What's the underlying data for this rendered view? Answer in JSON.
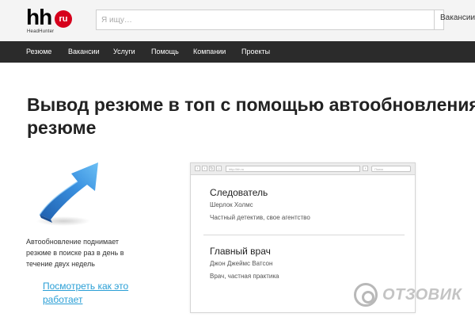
{
  "header": {
    "logo_text": "hh",
    "logo_badge": "ru",
    "logo_subtitle": "HeadHunter",
    "search_placeholder": "Я ищу…",
    "search_scope": "Вакансии"
  },
  "nav": {
    "items": [
      "Резюме",
      "Вакансии",
      "Услуги",
      "Помощь",
      "Компании",
      "Проекты"
    ]
  },
  "page": {
    "title_line1": "Вывод резюме в топ с помощью автообновления",
    "title_line2": "резюме",
    "description": "Автообновление поднимает резюме в поиске раз в день в течение двух недель",
    "link": "Посмотреть как это работает"
  },
  "mock_browser": {
    "url": "http://hh.ru",
    "search": "Поиск",
    "results": [
      {
        "title": "Следователь",
        "name": "Шерлок Холмс",
        "detail": "Частный детектив, свое агентство"
      },
      {
        "title": "Главный врач",
        "name": "Джон Джеймс Ватсон",
        "detail": "Врач, частная практика"
      }
    ]
  },
  "watermark": {
    "text": "ОТЗОВИК"
  },
  "colors": {
    "nav_bg": "#2b2b2b",
    "logo_badge": "#d6001c",
    "link": "#2a9fd6",
    "arrow": "#2f86d8"
  },
  "icons": {
    "arrow": "blue-3d-up-arrow-icon",
    "watermark": "otzovik-logo-icon"
  }
}
